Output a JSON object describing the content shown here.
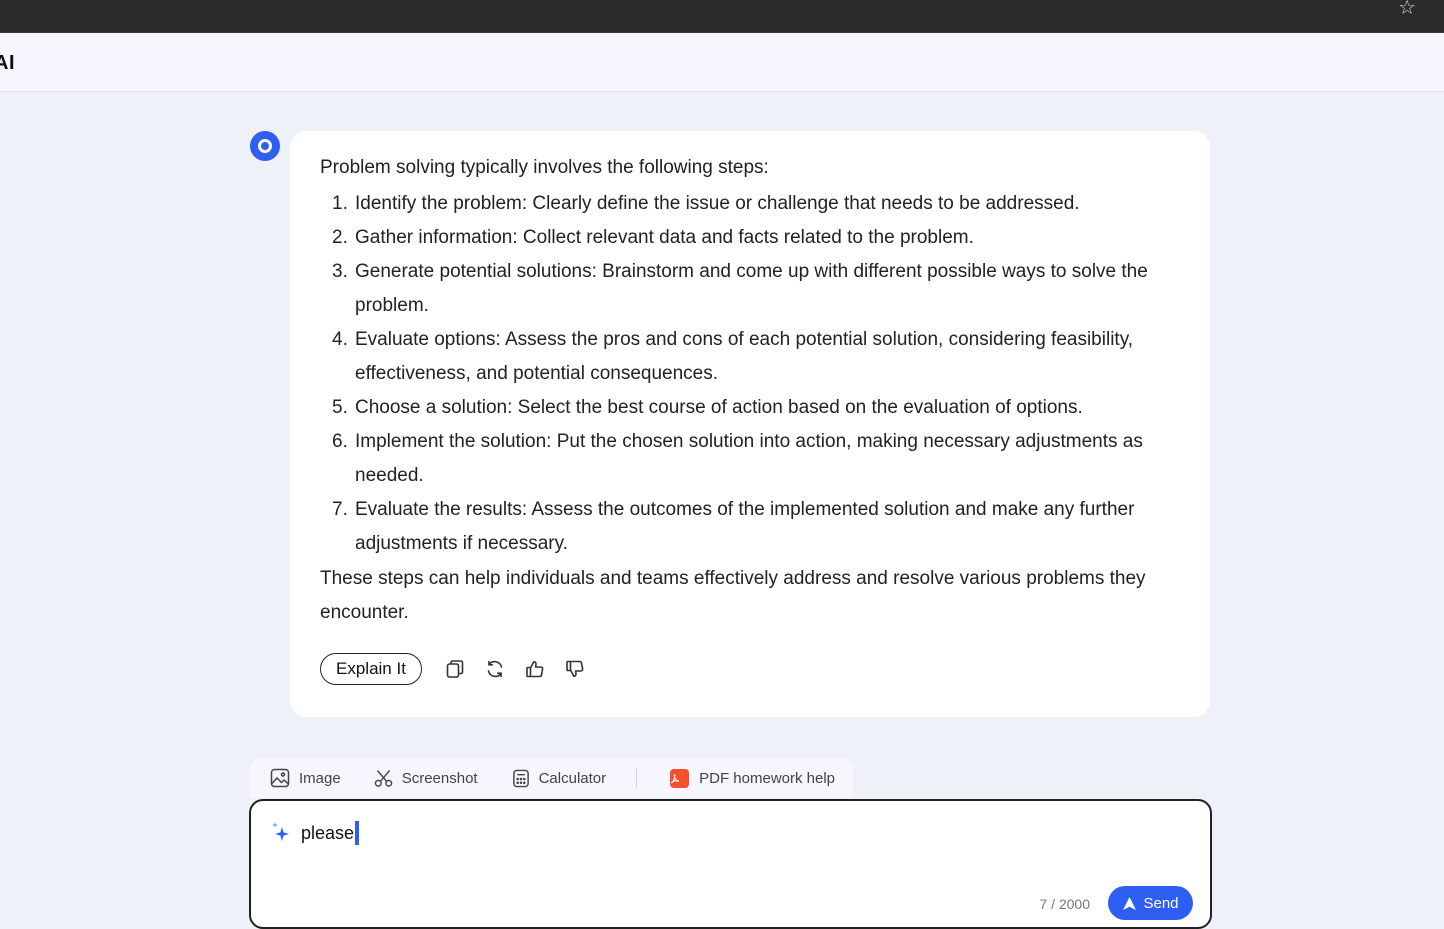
{
  "browser": {
    "bookmark_icon": "star-outline-icon"
  },
  "app": {
    "logo_text": "AI"
  },
  "message": {
    "avatar_icon": "assistant-avatar-icon",
    "intro": "Problem solving typically involves the following steps:",
    "steps": [
      {
        "num": "1.",
        "text": "Identify the problem: Clearly define the issue or challenge that needs to be addressed."
      },
      {
        "num": "2.",
        "text": "Gather information: Collect relevant data and facts related to the problem."
      },
      {
        "num": "3.",
        "text": "Generate potential solutions: Brainstorm and come up with different possible ways to solve the problem."
      },
      {
        "num": "4.",
        "text": "Evaluate options: Assess the pros and cons of each potential solution, considering feasibility, effectiveness, and potential consequences."
      },
      {
        "num": "5.",
        "text": "Choose a solution: Select the best course of action based on the evaluation of options."
      },
      {
        "num": "6.",
        "text": "Implement the solution: Put the chosen solution into action, making necessary adjustments as needed."
      },
      {
        "num": "7.",
        "text": "Evaluate the results: Assess the outcomes of the implemented solution and make any further adjustments if necessary."
      }
    ],
    "outro": "These steps can help individuals and teams effectively address and resolve various problems they encounter.",
    "actions": {
      "explain_label": "Explain It",
      "icons": [
        "copy-icon",
        "regenerate-icon",
        "thumbs-up-icon",
        "thumbs-down-icon"
      ]
    }
  },
  "tools": {
    "image_label": "Image",
    "screenshot_label": "Screenshot",
    "calculator_label": "Calculator",
    "pdf_label": "PDF homework help"
  },
  "composer": {
    "value": "please",
    "counter": "7 / 2000",
    "send_label": "Send"
  },
  "colors": {
    "accent": "#2f5ff2",
    "page_bg": "#eff1f9",
    "pdf_badge": "#f5502e"
  }
}
